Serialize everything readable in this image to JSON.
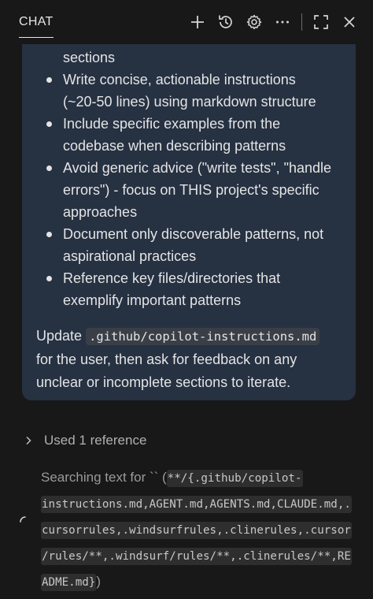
{
  "header": {
    "tab_label": "CHAT",
    "icons": [
      "plus-icon",
      "history-icon",
      "gear-icon",
      "ellipsis-icon",
      "maximize-icon",
      "close-icon"
    ]
  },
  "message": {
    "list_items": [
      {
        "lines": [
          "sections"
        ],
        "bullet": false
      },
      {
        "lines": [
          "Write concise, actionable instructions",
          "(~20-50 lines) using markdown structure"
        ],
        "bullet": true
      },
      {
        "lines": [
          "Include specific examples from the",
          "codebase when describing patterns"
        ],
        "bullet": true
      },
      {
        "lines": [
          "Avoid generic advice (\"write tests\", \"handle",
          "errors\") - focus on THIS project's specific",
          "approaches"
        ],
        "bullet": true
      },
      {
        "lines": [
          "Document only discoverable patterns, not",
          "aspirational practices"
        ],
        "bullet": true
      },
      {
        "lines": [
          "Reference key files/directories that",
          "exemplify important patterns"
        ],
        "bullet": true
      }
    ],
    "update_prefix": "Update",
    "update_code": ".github/copilot-instructions.md",
    "update_suffix_line1": "for the user, then ask for feedback on any",
    "update_suffix_line2": "unclear or incomplete sections to iterate."
  },
  "references": {
    "label": "Used 1 reference"
  },
  "search": {
    "prefix": "Searching text for `` (",
    "lines": [
      "**/{.github/copilot-",
      "instructions.md,AGENT.md,AGENTS.md,CLAUDE.md,.",
      "cursorrules,.windsurfrules,.clinerules,.cursor",
      "/rules/**,.windsurf/rules/**,.clinerules/**,RE",
      "ADME.md}"
    ],
    "suffix": ")"
  },
  "colors": {
    "background": "#181818",
    "bubble": "#263142",
    "text": "#e4e4e4",
    "muted": "#9a9a9a"
  }
}
